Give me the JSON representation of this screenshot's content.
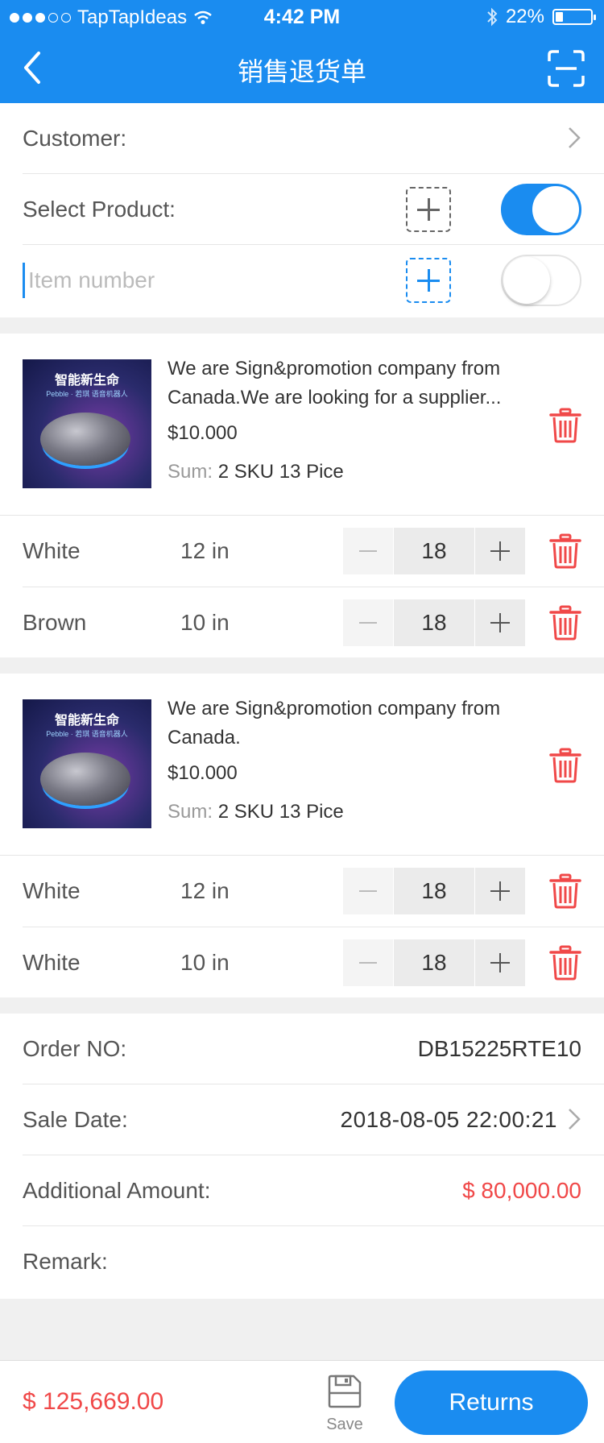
{
  "status_bar": {
    "carrier": "TapTapIdeas",
    "time": "4:42 PM",
    "battery": "22%",
    "battery_level": 0.22
  },
  "header": {
    "title": "销售退货单"
  },
  "form": {
    "customer_label": "Customer:",
    "select_product_label": "Select Product:",
    "select_product_toggle": true,
    "item_number_placeholder": "Item number",
    "item_number_toggle": false
  },
  "products": [
    {
      "name": "We are Sign&promotion company from Canada.We are looking for a supplier...",
      "price": "$10.000",
      "sum_label": "Sum:",
      "sum_value": "2 SKU 13 Pice",
      "image_title": "智能新生命",
      "image_subtitle": "Pebble · 若琪 语音机器人",
      "variants": [
        {
          "color": "White",
          "size": "12 in",
          "qty": "18"
        },
        {
          "color": "Brown",
          "size": "10 in",
          "qty": "18"
        }
      ]
    },
    {
      "name": "We are Sign&promotion company from Canada.",
      "price": "$10.000",
      "sum_label": "Sum:",
      "sum_value": "2 SKU 13 Pice",
      "image_title": "智能新生命",
      "image_subtitle": "Pebble · 若琪 语音机器人",
      "variants": [
        {
          "color": "White",
          "size": "12 in",
          "qty": "18"
        },
        {
          "color": "White",
          "size": "10 in",
          "qty": "18"
        }
      ]
    }
  ],
  "order": {
    "order_no_label": "Order NO:",
    "order_no": "DB15225RTE10",
    "sale_date_label": "Sale Date:",
    "sale_date": "2018-08-05 22:00:21",
    "additional_amount_label": "Additional Amount:",
    "additional_amount": "$ 80,000.00",
    "remark_label": "Remark:"
  },
  "footer": {
    "total": "$ 125,669.00",
    "save_label": "Save",
    "returns_label": "Returns"
  },
  "colors": {
    "accent": "#1a8cf0",
    "danger": "#f04848"
  }
}
